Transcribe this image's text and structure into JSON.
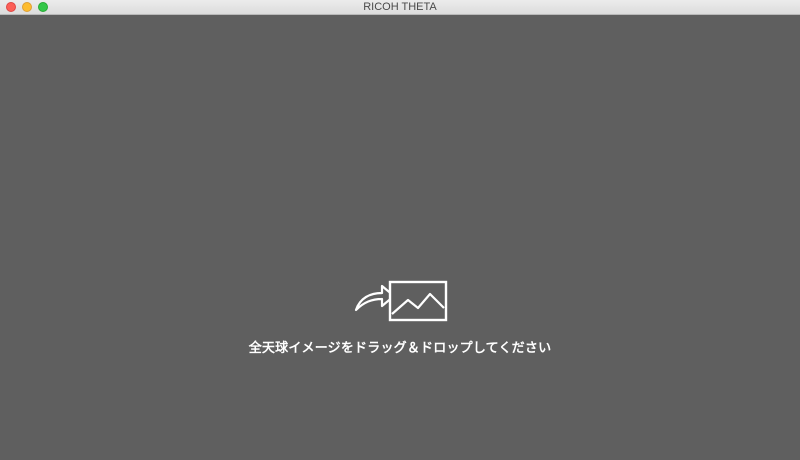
{
  "window": {
    "title": "RICOH THETA"
  },
  "drop_zone": {
    "message": "全天球イメージをドラッグ＆ドロップしてください",
    "icon": "drag-drop-image-icon"
  },
  "colors": {
    "background": "#5f5f5f",
    "text": "#ffffff"
  }
}
